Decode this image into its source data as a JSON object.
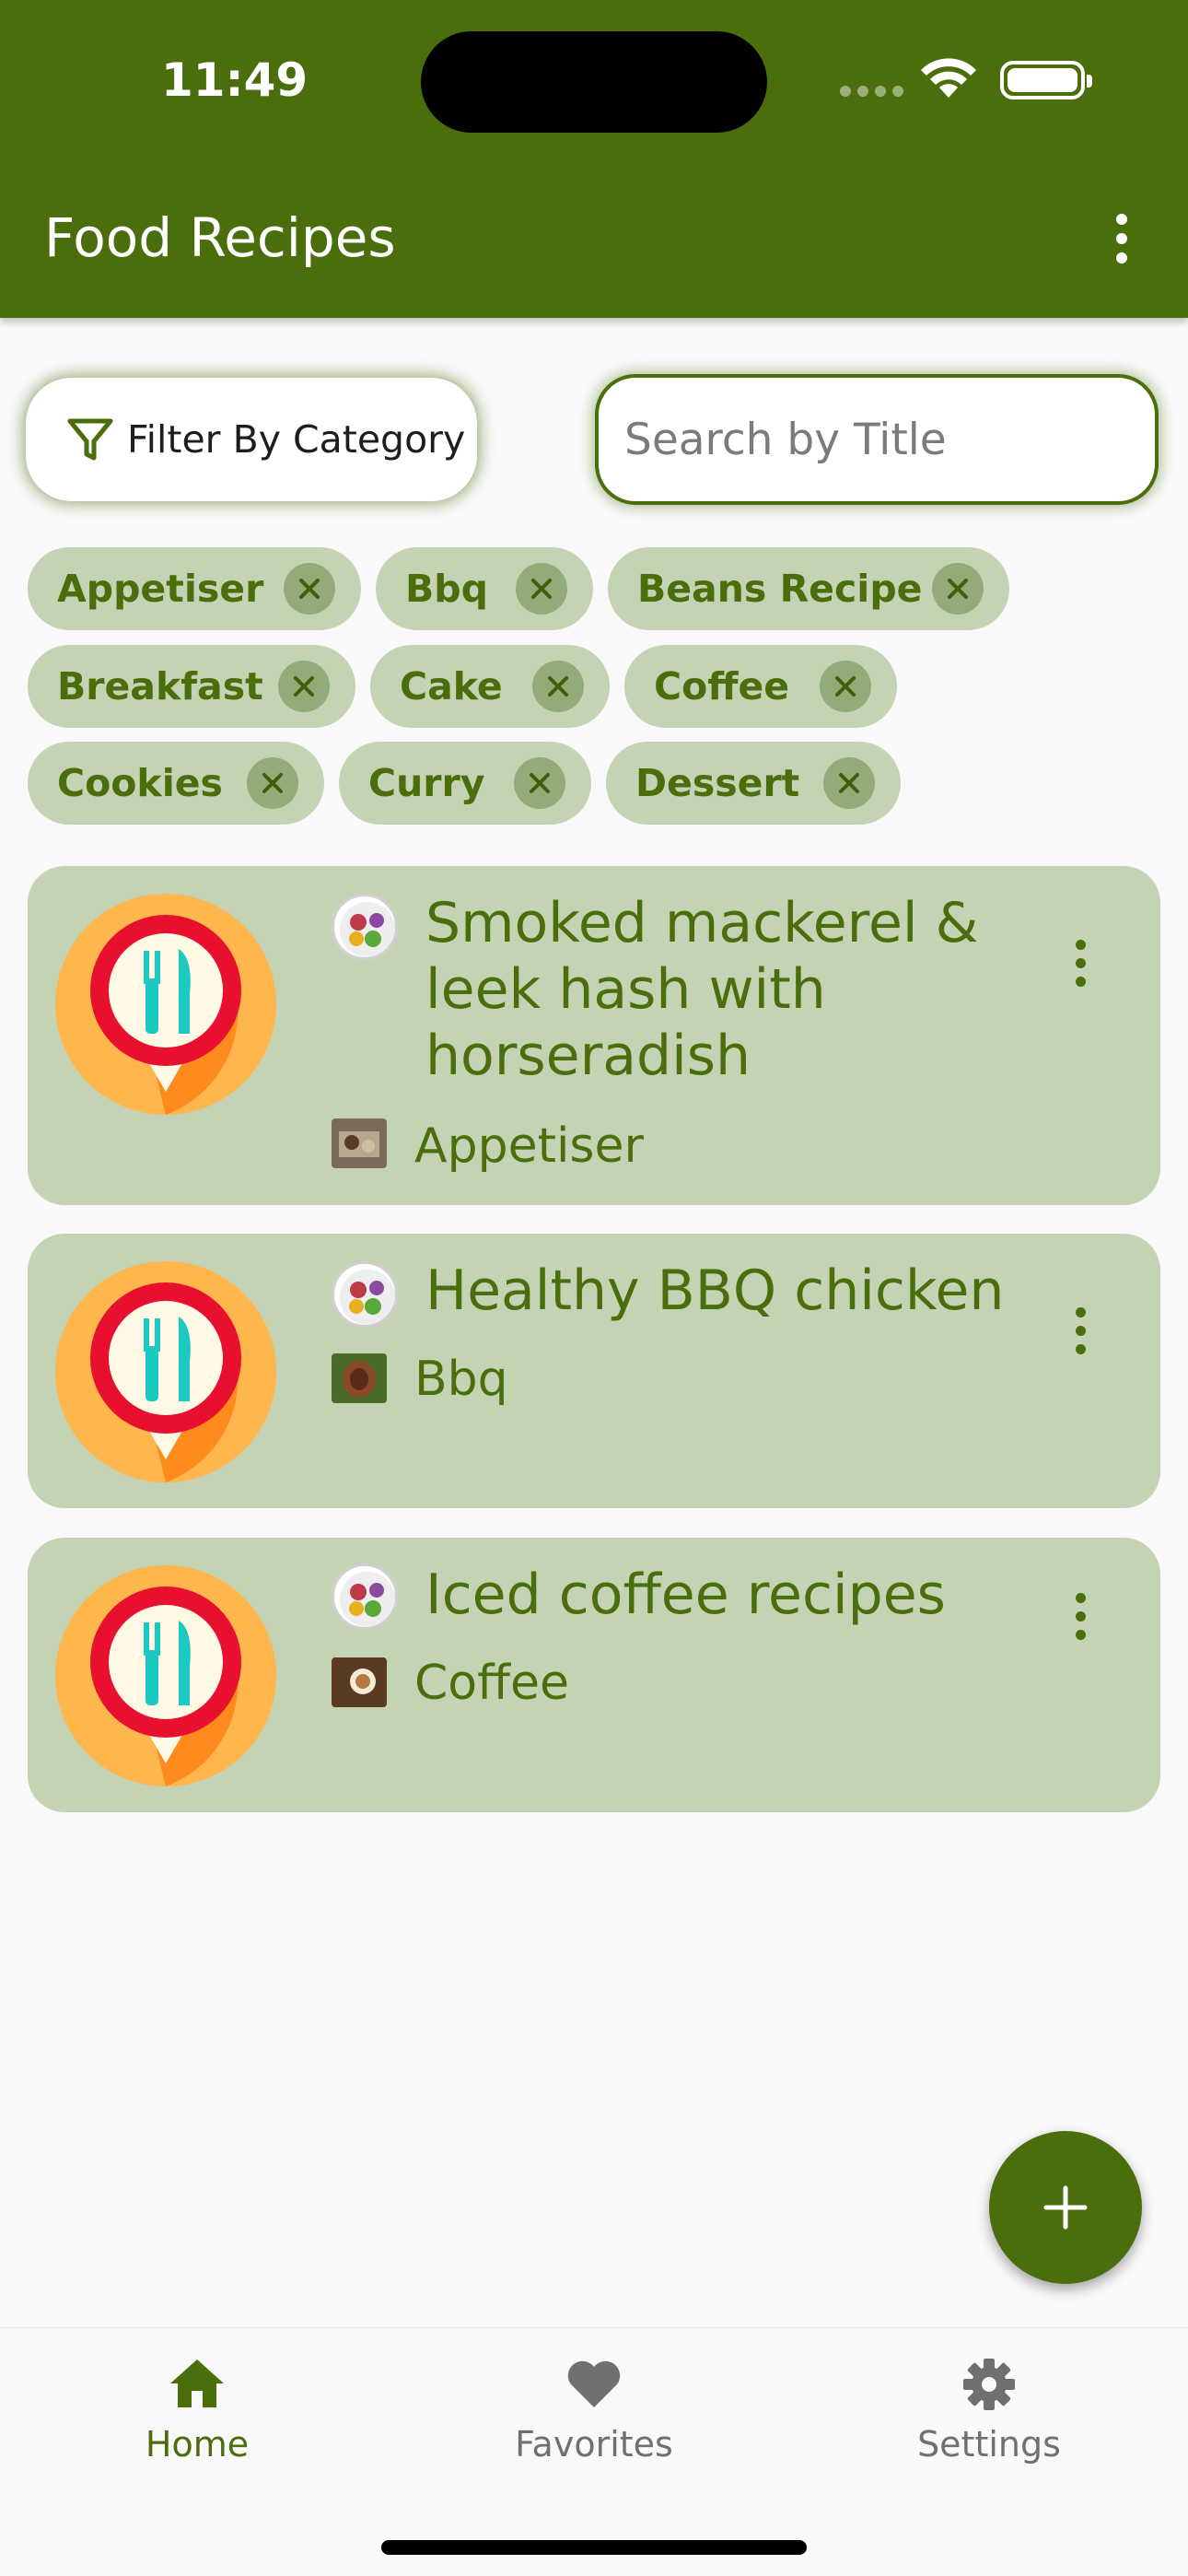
{
  "status_bar": {
    "time": "11:49"
  },
  "app_bar": {
    "title": "Food Recipes"
  },
  "filter": {
    "label": "Filter By Category"
  },
  "search": {
    "placeholder": "Search by Title",
    "value": ""
  },
  "chips": [
    {
      "label": "Appetiser"
    },
    {
      "label": "Bbq"
    },
    {
      "label": "Beans Recipe"
    },
    {
      "label": "Breakfast"
    },
    {
      "label": "Cake"
    },
    {
      "label": "Coffee"
    },
    {
      "label": "Cookies"
    },
    {
      "label": "Curry"
    },
    {
      "label": "Dessert"
    }
  ],
  "recipes": [
    {
      "title": "Smoked mackerel & leek hash with horseradish",
      "category": "Appetiser"
    },
    {
      "title": "Healthy BBQ chicken",
      "category": "Bbq"
    },
    {
      "title": "Iced coffee recipes",
      "category": "Coffee"
    }
  ],
  "bottom_nav": {
    "home": "Home",
    "favorites": "Favorites",
    "settings": "Settings"
  },
  "colors": {
    "primary": "#4a6e0c",
    "chip_bg": "#c4d3b4",
    "inactive_nav": "#707070"
  },
  "icons": [
    "filter-icon",
    "close-icon",
    "more-vert-icon",
    "plus-icon",
    "home-icon",
    "heart-icon",
    "gear-icon",
    "wifi-icon",
    "battery-icon"
  ]
}
